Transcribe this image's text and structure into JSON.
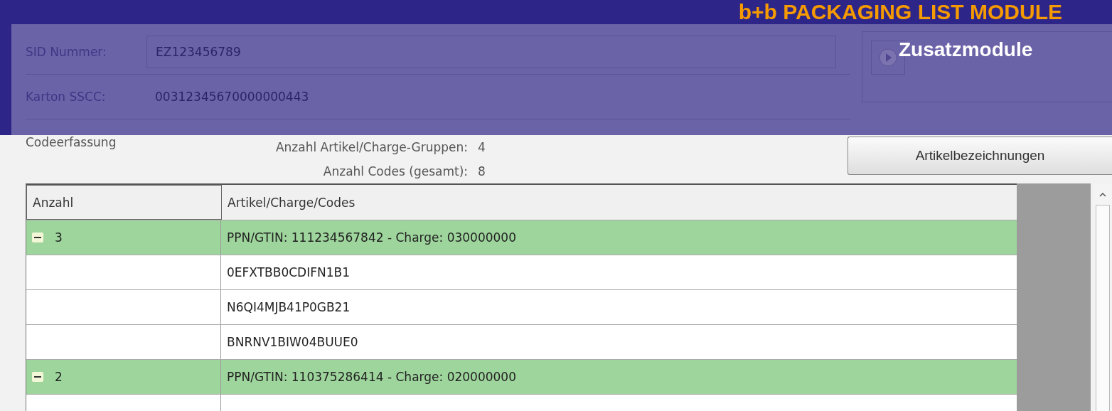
{
  "banner": {
    "title": "b+b PACKAGING LIST MODULE",
    "subtitle": "Zusatzmodule"
  },
  "form": {
    "fields": [
      {
        "label": "SID Nummer:",
        "value": "EZ123456789"
      },
      {
        "label": "Karton SSCC:",
        "value": "00312345670000000443"
      }
    ]
  },
  "summary": {
    "section": "Codeerfassung",
    "items": [
      {
        "label": "Anzahl Artikel/Charge-Gruppen:",
        "value": "4"
      },
      {
        "label": "Anzahl Codes (gesamt):",
        "value": "8"
      }
    ]
  },
  "buttons": [
    "Artikelbezeichnungen"
  ],
  "table": {
    "columns": [
      "Anzahl",
      "Artikel/Charge/Codes"
    ],
    "groups": [
      {
        "count": "3",
        "text": "PPN/GTIN: 111234567842 - Charge: 030000000",
        "expanded": true,
        "children": [
          "0EFXTBB0CDIFN1B1",
          "N6QI4MJB41P0GB21",
          "BNRNV1BIW04BUUE0"
        ]
      },
      {
        "count": "2",
        "text": "PPN/GTIN: 110375286414 - Charge: 020000000",
        "expanded": true
      }
    ]
  }
}
